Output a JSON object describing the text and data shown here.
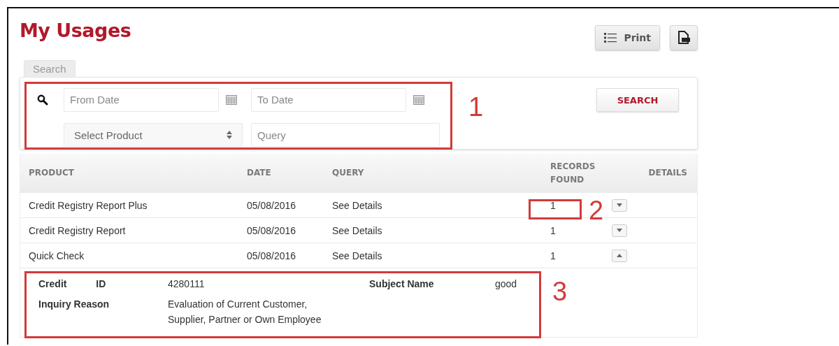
{
  "page": {
    "title": "My Usages"
  },
  "actions": {
    "print": "Print"
  },
  "tabs": [
    {
      "label": "Search",
      "selected": true
    }
  ],
  "search": {
    "from_date": {
      "placeholder": "From Date"
    },
    "to_date": {
      "placeholder": "To Date"
    },
    "product": {
      "placeholder": "Select Product"
    },
    "query": {
      "placeholder": "Query"
    },
    "button": "SEARCH"
  },
  "table": {
    "columns": [
      "PRODUCT",
      "DATE",
      "QUERY",
      "RECORDS FOUND",
      "DETAILS"
    ],
    "rows": [
      {
        "product": "Credit Registry Report Plus",
        "date": "05/08/2016",
        "query": "See Details",
        "records": "1",
        "expanded": false
      },
      {
        "product": "Credit Registry Report",
        "date": "05/08/2016",
        "query": "See Details",
        "records": "1",
        "expanded": false
      },
      {
        "product": "Quick Check",
        "date": "05/08/2016",
        "query": "See Details",
        "records": "1",
        "expanded": true
      }
    ],
    "detail": {
      "credit_id_label": "Credit ID",
      "credit_id": "4280111",
      "subject_label": "Subject Name",
      "subject": "good",
      "reason_label": "Inquiry Reason",
      "reason_lines": [
        "Evaluation of Current Customer,",
        "Supplier, Partner or Own Employee"
      ]
    }
  },
  "annotations": [
    {
      "label": "1"
    },
    {
      "label": "2"
    },
    {
      "label": "3"
    }
  ]
}
